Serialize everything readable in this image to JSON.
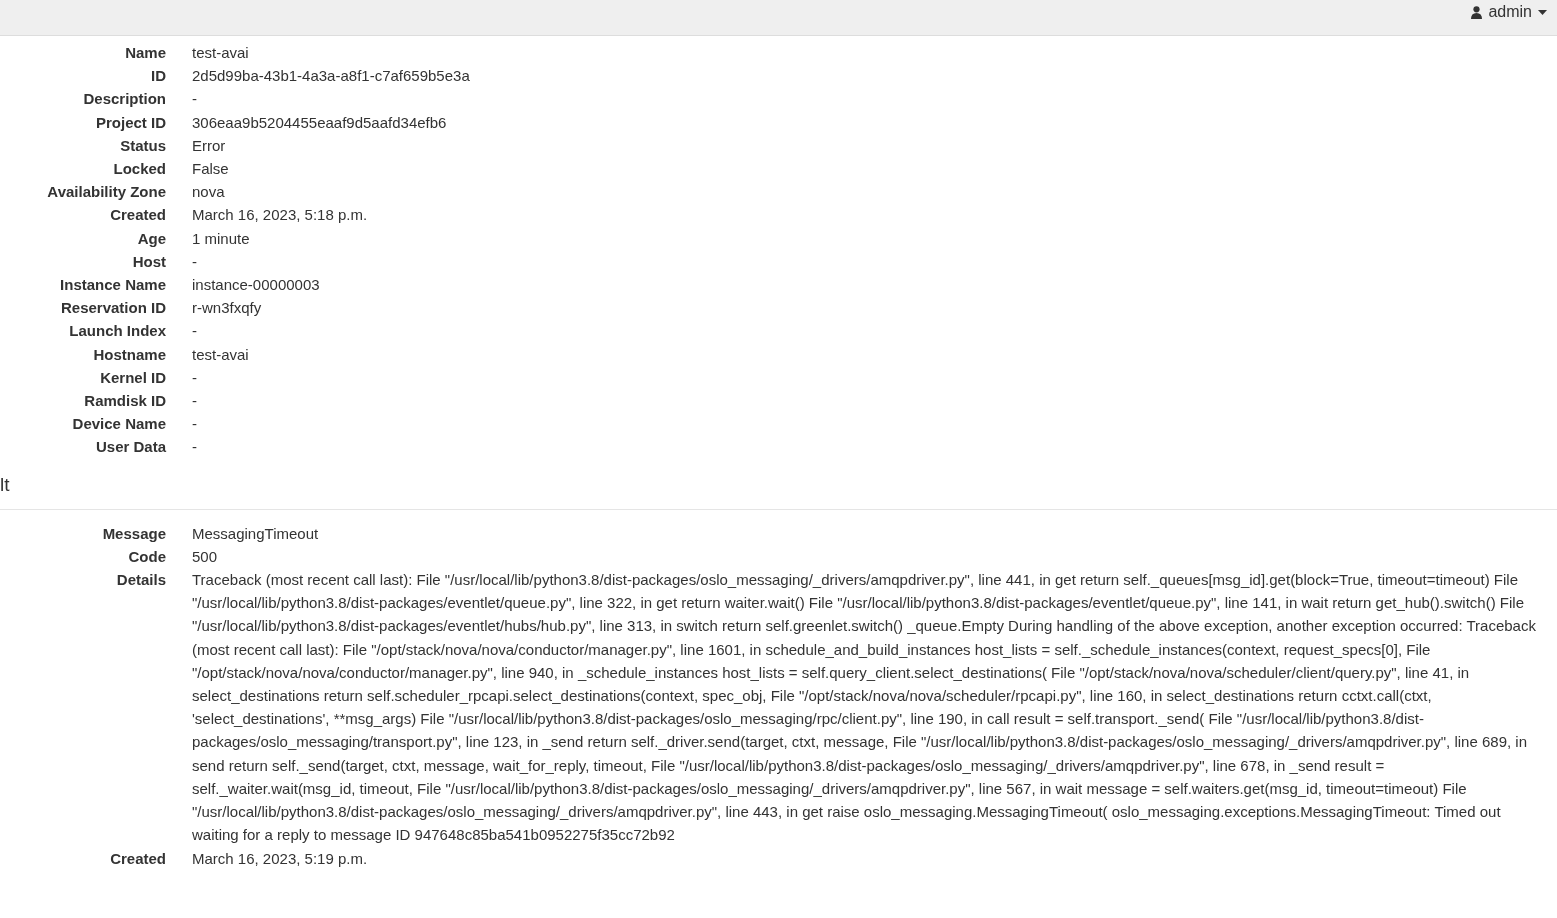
{
  "top_bar": {
    "user": "admin"
  },
  "overview": [
    {
      "label": "Name",
      "value": "test-avai"
    },
    {
      "label": "ID",
      "value": "2d5d99ba-43b1-4a3a-a8f1-c7af659b5e3a"
    },
    {
      "label": "Description",
      "value": "-"
    },
    {
      "label": "Project ID",
      "value": "306eaa9b5204455eaaf9d5aafd34efb6"
    },
    {
      "label": "Status",
      "value": "Error"
    },
    {
      "label": "Locked",
      "value": "False"
    },
    {
      "label": "Availability Zone",
      "value": "nova"
    },
    {
      "label": "Created",
      "value": "March 16, 2023, 5:18 p.m."
    },
    {
      "label": "Age",
      "value": "1 minute"
    },
    {
      "label": "Host",
      "value": "-"
    },
    {
      "label": "Instance Name",
      "value": "instance-00000003"
    },
    {
      "label": "Reservation ID",
      "value": "r-wn3fxqfy"
    },
    {
      "label": "Launch Index",
      "value": "-"
    },
    {
      "label": "Hostname",
      "value": "test-avai"
    },
    {
      "label": "Kernel ID",
      "value": "-"
    },
    {
      "label": "Ramdisk ID",
      "value": "-"
    },
    {
      "label": "Device Name",
      "value": "-"
    },
    {
      "label": "User Data",
      "value": "-"
    }
  ],
  "fault": {
    "heading": "lt",
    "rows": [
      {
        "label": "Message",
        "value": "MessagingTimeout"
      },
      {
        "label": "Code",
        "value": "500"
      },
      {
        "label": "Details",
        "value": "Traceback (most recent call last): File \"/usr/local/lib/python3.8/dist-packages/oslo_messaging/_drivers/amqpdriver.py\", line 441, in get return self._queues[msg_id].get(block=True, timeout=timeout) File \"/usr/local/lib/python3.8/dist-packages/eventlet/queue.py\", line 322, in get return waiter.wait() File \"/usr/local/lib/python3.8/dist-packages/eventlet/queue.py\", line 141, in wait return get_hub().switch() File \"/usr/local/lib/python3.8/dist-packages/eventlet/hubs/hub.py\", line 313, in switch return self.greenlet.switch() _queue.Empty During handling of the above exception, another exception occurred: Traceback (most recent call last): File \"/opt/stack/nova/nova/conductor/manager.py\", line 1601, in schedule_and_build_instances host_lists = self._schedule_instances(context, request_specs[0], File \"/opt/stack/nova/nova/conductor/manager.py\", line 940, in _schedule_instances host_lists = self.query_client.select_destinations( File \"/opt/stack/nova/nova/scheduler/client/query.py\", line 41, in select_destinations return self.scheduler_rpcapi.select_destinations(context, spec_obj, File \"/opt/stack/nova/nova/scheduler/rpcapi.py\", line 160, in select_destinations return cctxt.call(ctxt, 'select_destinations', **msg_args) File \"/usr/local/lib/python3.8/dist-packages/oslo_messaging/rpc/client.py\", line 190, in call result = self.transport._send( File \"/usr/local/lib/python3.8/dist-packages/oslo_messaging/transport.py\", line 123, in _send return self._driver.send(target, ctxt, message, File \"/usr/local/lib/python3.8/dist-packages/oslo_messaging/_drivers/amqpdriver.py\", line 689, in send return self._send(target, ctxt, message, wait_for_reply, timeout, File \"/usr/local/lib/python3.8/dist-packages/oslo_messaging/_drivers/amqpdriver.py\", line 678, in _send result = self._waiter.wait(msg_id, timeout, File \"/usr/local/lib/python3.8/dist-packages/oslo_messaging/_drivers/amqpdriver.py\", line 567, in wait message = self.waiters.get(msg_id, timeout=timeout) File \"/usr/local/lib/python3.8/dist-packages/oslo_messaging/_drivers/amqpdriver.py\", line 443, in get raise oslo_messaging.MessagingTimeout( oslo_messaging.exceptions.MessagingTimeout: Timed out waiting for a reply to message ID 947648c85ba541b0952275f35cc72b92"
      },
      {
        "label": "Created",
        "value": "March 16, 2023, 5:19 p.m."
      }
    ]
  }
}
